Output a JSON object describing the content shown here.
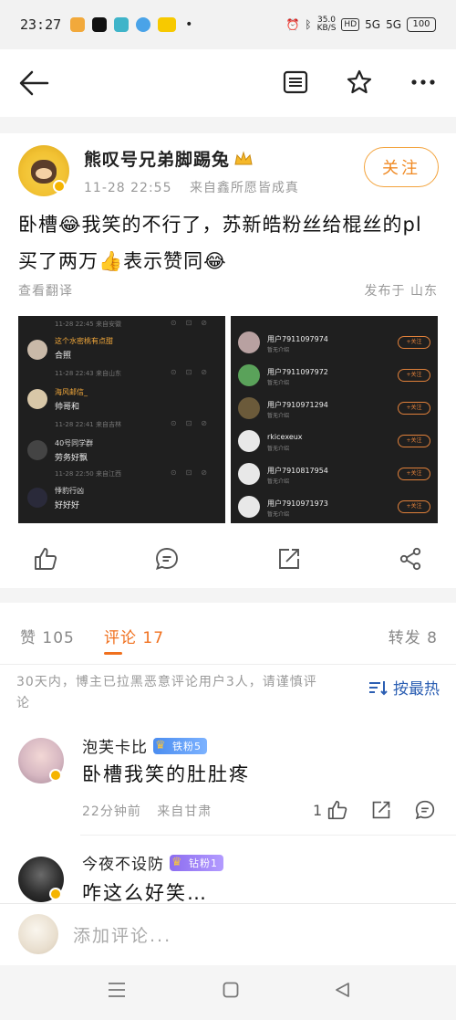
{
  "status_bar": {
    "time": "23:27",
    "net_speed_value": "35.0",
    "net_speed_unit": "KB/S",
    "hd_tag": "HD",
    "signal_1": "5G",
    "signal_2": "5G",
    "battery": "100"
  },
  "header": {
    "icons": [
      "back-arrow-icon",
      "menu-list-icon",
      "star-icon",
      "more-dots-icon"
    ]
  },
  "post": {
    "author": "熊叹号兄弟脚踢兔",
    "time": "11-28 22:55",
    "source": "来自鑫所愿皆成真",
    "follow_label": "关注",
    "text": "卧槽😂我笑的不行了，苏新皓粉丝给棍丝的pl买了两万👍表示赞同😂",
    "translate_label": "查看翻译",
    "location": "发布于 山东",
    "image_left": {
      "rows": [
        {
          "meta": "11-28 22:45 来自安徽",
          "name": "这个水密桃有点甜",
          "text": "合照"
        },
        {
          "meta": "11-28 22:43 来自山东",
          "name": "海风邮信_",
          "text": "帅哥和"
        },
        {
          "meta": "11-28 22:41 来自吉林",
          "name": "40号同学群",
          "text": "劳务好飘"
        },
        {
          "meta": "11-28 22:50 来自江西",
          "name": "悸豹行凶",
          "text": "好好好"
        }
      ]
    },
    "image_right": {
      "rows": [
        {
          "name": "用户7911097974",
          "sub": "暂无介绍",
          "btn": "+关注"
        },
        {
          "name": "用户7911097972",
          "sub": "暂无介绍",
          "btn": "+关注"
        },
        {
          "name": "用户7910971294",
          "sub": "暂无介绍",
          "btn": "+关注"
        },
        {
          "name": "rkicexeux",
          "sub": "暂无介绍",
          "btn": "+关注"
        },
        {
          "name": "用户7910817954",
          "sub": "暂无介绍",
          "btn": "+关注"
        },
        {
          "name": "用户7910971973",
          "sub": "暂无介绍",
          "btn": "+关注"
        }
      ]
    }
  },
  "tabs": {
    "likes": "赞 105",
    "comments": "评论 17",
    "reposts": "转发 8"
  },
  "notice": "30天内，博主已拉黑恶意评论用户3人，请谨慎评论",
  "sort_label": "按最热",
  "comments": [
    {
      "name": "泡芙卡比",
      "badge": "铁粉5",
      "text": "卧槽我笑的肚肚疼",
      "time": "22分钟前",
      "source": "来自甘肃",
      "likes": "1"
    },
    {
      "name": "今夜不设防",
      "badge": "钻粉1",
      "text": "咋这么好笑…"
    }
  ],
  "input": {
    "placeholder": "添加评论..."
  },
  "colors": {
    "accent_orange": "#f0701e",
    "sort_blue": "#2c5fb3",
    "follow_border": "#f3a33c"
  }
}
